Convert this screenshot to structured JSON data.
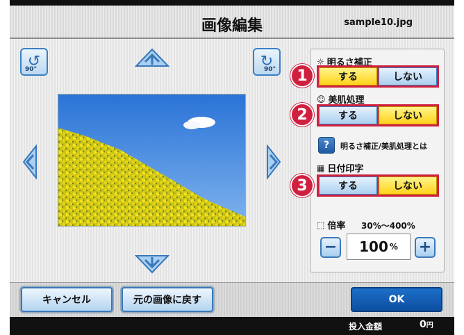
{
  "header": {
    "title": "画像編集",
    "filename": "sample10.jpg"
  },
  "rotate": {
    "left_degree": "90°",
    "right_degree": "90°"
  },
  "panel": {
    "brightness": {
      "label": "明るさ補正",
      "on": "する",
      "off": "しない",
      "selected": "on",
      "badge": "1"
    },
    "skin": {
      "label": "美肌処理",
      "on": "する",
      "off": "しない",
      "selected": "off",
      "badge": "2"
    },
    "help_text": "明るさ補正/美肌処理とは",
    "help_icon": "?",
    "date": {
      "label": "日付印字",
      "on": "する",
      "off": "しない",
      "selected": "off",
      "badge": "3"
    },
    "zoom": {
      "label": "倍率",
      "range": "30%～400%",
      "value": "100",
      "unit": "%",
      "minus": "−",
      "plus": "+"
    }
  },
  "footer_buttons": {
    "cancel": "キャンセル",
    "restore": "元の画像に戻す",
    "ok": "OK"
  },
  "status": {
    "deposit_label": "投入金額",
    "deposit_value": "0",
    "deposit_unit": "円"
  },
  "colors": {
    "accent_red": "#d0203f",
    "selected_yellow": "#ffd21a",
    "ok_blue": "#0d4fa0"
  }
}
